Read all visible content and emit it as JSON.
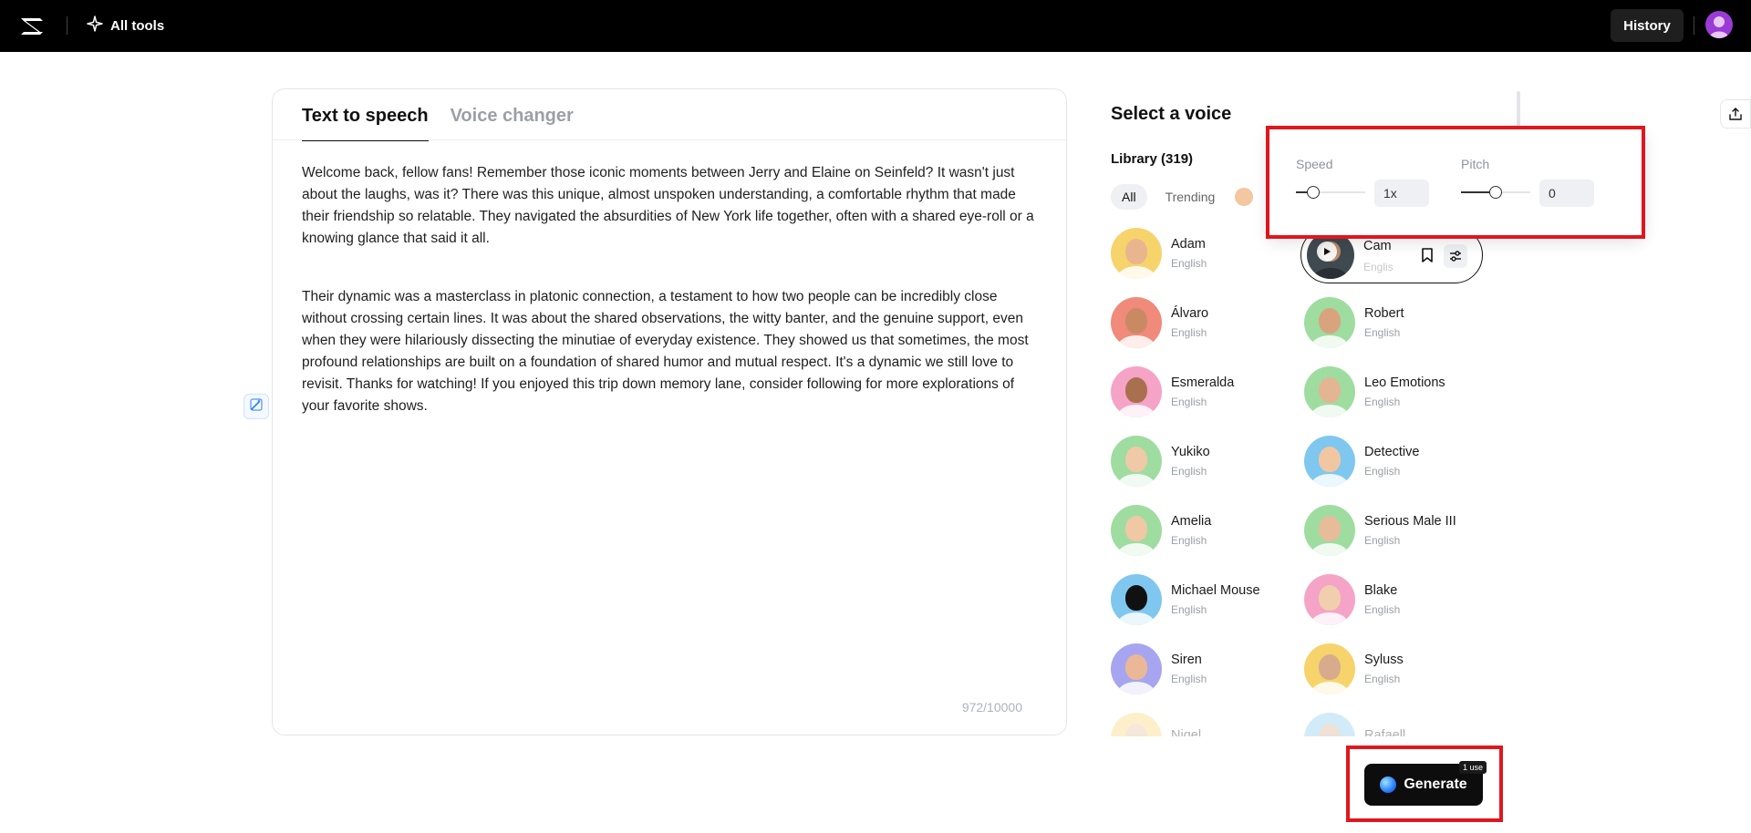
{
  "header": {
    "all_tools_label": "All tools",
    "history_label": "History"
  },
  "editor": {
    "tabs": [
      {
        "label": "Text to speech",
        "active": true
      },
      {
        "label": "Voice changer",
        "active": false
      }
    ],
    "paragraphs": [
      "Welcome back, fellow fans! Remember those iconic moments between Jerry and Elaine on Seinfeld? It wasn't just about the laughs, was it? There was this unique, almost unspoken understanding, a comfortable rhythm that made their friendship so relatable. They navigated the absurdities of New York life together, often with a shared eye-roll or a knowing glance that said it all.",
      "Their dynamic was a masterclass in platonic connection, a testament to how two people can be incredibly close without crossing certain lines. It was about the shared observations, the witty banter, and the genuine support, even when they were hilariously dissecting the minutiae of everyday existence. They showed us that sometimes, the most profound relationships are built on a foundation of shared humor and mutual respect. It's a dynamic we still love to revisit. Thanks for watching! If you enjoyed this trip down memory lane, consider following for more explorations of your favorite shows."
    ],
    "char_count": "972/10000"
  },
  "voice_panel": {
    "title": "Select a voice",
    "library_label": "Library (319)",
    "filters": [
      "All",
      "Trending"
    ],
    "selected": {
      "name": "Cam",
      "lang": "Englis"
    },
    "voices": [
      {
        "name": "Adam",
        "lang": "English",
        "bg": "#f7d36b",
        "skin": "#e8b58f"
      },
      {
        "name": "Álvaro",
        "lang": "English",
        "bg": "#f08a7a",
        "skin": "#c98a63"
      },
      {
        "name": "Robert",
        "lang": "English",
        "bg": "#9fdca0",
        "skin": "#d9a37e"
      },
      {
        "name": "Esmeralda",
        "lang": "English",
        "bg": "#f5a3c7",
        "skin": "#a8704f"
      },
      {
        "name": "Leo Emotions",
        "lang": "English",
        "bg": "#9fdca0",
        "skin": "#e3b593"
      },
      {
        "name": "Yukiko",
        "lang": "English",
        "bg": "#9fdca0",
        "skin": "#efc9a8"
      },
      {
        "name": "Detective",
        "lang": "English",
        "bg": "#7fc7ef",
        "skin": "#f1c7a3"
      },
      {
        "name": "Amelia",
        "lang": "English",
        "bg": "#9fdca0",
        "skin": "#f0c8a6"
      },
      {
        "name": "Serious Male III",
        "lang": "English",
        "bg": "#9fdca0",
        "skin": "#e6bc9b"
      },
      {
        "name": "Michael Mouse",
        "lang": "English",
        "bg": "#7fc7ef",
        "skin": "#111111"
      },
      {
        "name": "Blake",
        "lang": "English",
        "bg": "#f5a3c7",
        "skin": "#f1cfae"
      },
      {
        "name": "Siren",
        "lang": "English",
        "bg": "#a7a5f0",
        "skin": "#eab898"
      },
      {
        "name": "Syluss",
        "lang": "English",
        "bg": "#f7d36b",
        "skin": "#d7ab8c"
      },
      {
        "name": "Nigel",
        "lang": "",
        "bg": "#f7d36b",
        "skin": "#e6bc9b"
      },
      {
        "name": "Rafaell",
        "lang": "",
        "bg": "#7fc7ef",
        "skin": "#d7ab8c"
      }
    ]
  },
  "popover": {
    "speed_label": "Speed",
    "speed_value": "1x",
    "speed_level": 0.25,
    "pitch_label": "Pitch",
    "pitch_value": "0",
    "pitch_level": 0.5
  },
  "generate": {
    "label": "Generate",
    "badge": "1 use"
  },
  "colors": {
    "highlight": "#e0161e",
    "avatar_top": "#9b3bd6"
  }
}
